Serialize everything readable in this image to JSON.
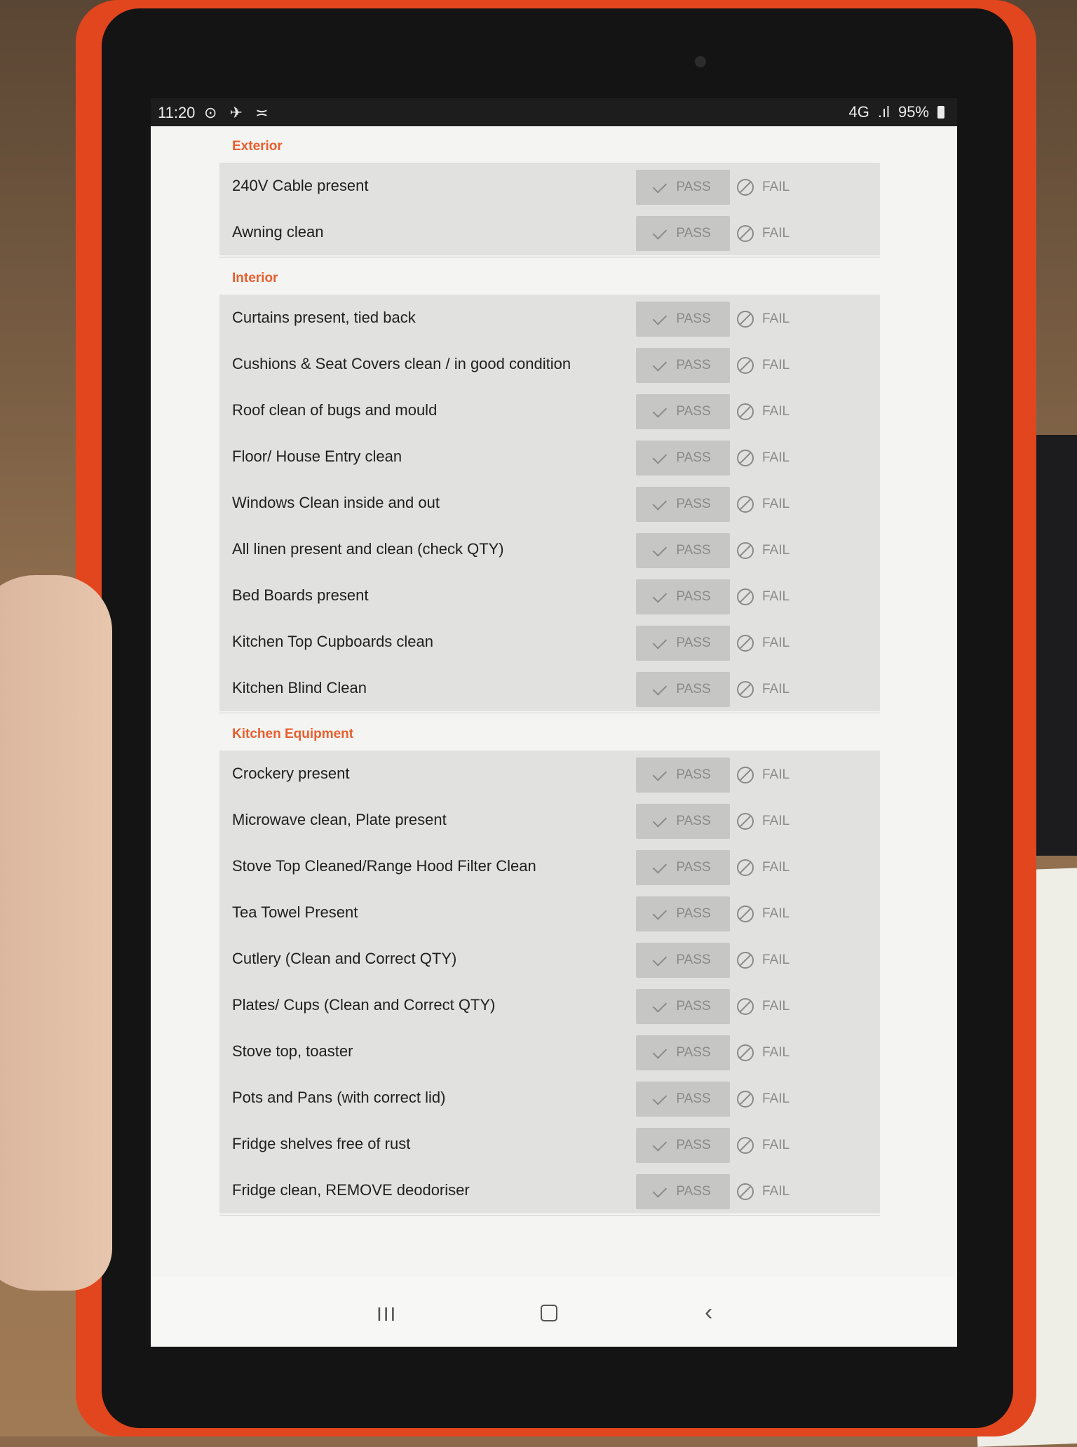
{
  "status_bar": {
    "time": "11:20",
    "left_icons": "⊙ ✈ ≍",
    "network": "4G",
    "signal": ".ıl",
    "battery": "95%"
  },
  "icons": {
    "pass": "check-icon",
    "fail": "ban-icon"
  },
  "sections": [
    {
      "title": "Exterior",
      "items": [
        {
          "label": "240V Cable present",
          "pass": "PASS",
          "fail": "FAIL"
        },
        {
          "label": "Awning clean",
          "pass": "PASS",
          "fail": "FAIL"
        }
      ]
    },
    {
      "title": "Interior",
      "items": [
        {
          "label": "Curtains present, tied back",
          "pass": "PASS",
          "fail": "FAIL"
        },
        {
          "label": "Cushions & Seat Covers clean / in good condition",
          "pass": "PASS",
          "fail": "FAIL"
        },
        {
          "label": "Roof clean of bugs and mould",
          "pass": "PASS",
          "fail": "FAIL"
        },
        {
          "label": "Floor/ House Entry clean",
          "pass": "PASS",
          "fail": "FAIL"
        },
        {
          "label": "Windows Clean inside and out",
          "pass": "PASS",
          "fail": "FAIL"
        },
        {
          "label": "All linen present and clean (check QTY)",
          "pass": "PASS",
          "fail": "FAIL"
        },
        {
          "label": "Bed Boards present",
          "pass": "PASS",
          "fail": "FAIL"
        },
        {
          "label": "Kitchen Top Cupboards clean",
          "pass": "PASS",
          "fail": "FAIL"
        },
        {
          "label": "Kitchen Blind Clean",
          "pass": "PASS",
          "fail": "FAIL"
        }
      ]
    },
    {
      "title": "Kitchen Equipment",
      "items": [
        {
          "label": "Crockery present",
          "pass": "PASS",
          "fail": "FAIL"
        },
        {
          "label": "Microwave clean, Plate present",
          "pass": "PASS",
          "fail": "FAIL"
        },
        {
          "label": "Stove Top Cleaned/Range Hood Filter Clean",
          "pass": "PASS",
          "fail": "FAIL"
        },
        {
          "label": "Tea Towel Present",
          "pass": "PASS",
          "fail": "FAIL"
        },
        {
          "label": "Cutlery (Clean and Correct QTY)",
          "pass": "PASS",
          "fail": "FAIL"
        },
        {
          "label": "Plates/ Cups (Clean and Correct QTY)",
          "pass": "PASS",
          "fail": "FAIL"
        },
        {
          "label": "Stove top, toaster",
          "pass": "PASS",
          "fail": "FAIL"
        },
        {
          "label": "Pots and Pans (with correct lid)",
          "pass": "PASS",
          "fail": "FAIL"
        },
        {
          "label": "Fridge shelves free of rust",
          "pass": "PASS",
          "fail": "FAIL"
        },
        {
          "label": "Fridge clean, REMOVE deodoriser",
          "pass": "PASS",
          "fail": "FAIL"
        }
      ]
    }
  ],
  "nav_bar": {
    "recents": "III",
    "back": "‹"
  }
}
